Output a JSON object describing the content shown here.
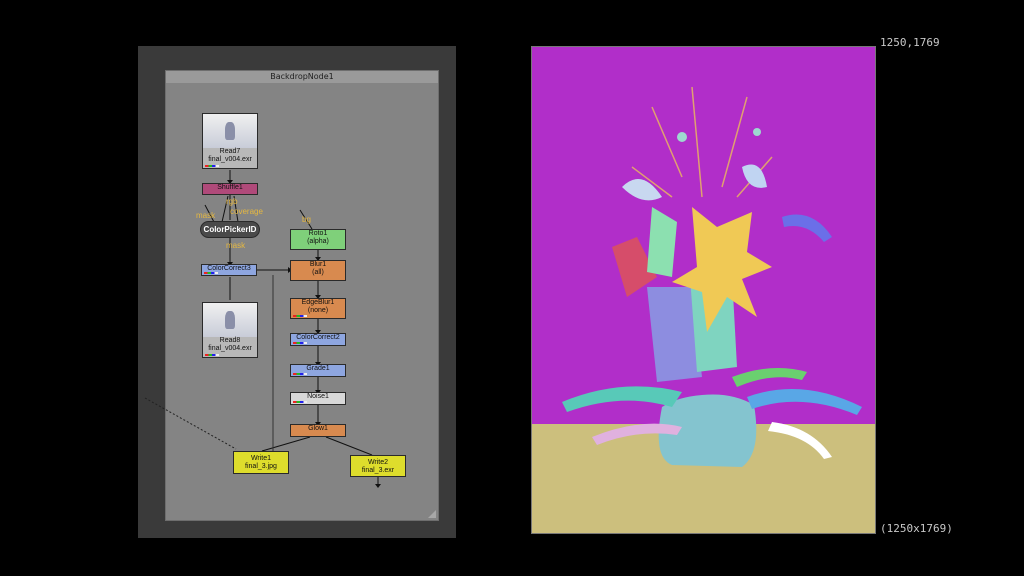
{
  "dag": {
    "backdrop_label": "BackdropNode1",
    "nodes": {
      "read7": {
        "name": "Read7",
        "file": "final_v004.exr"
      },
      "shuffle1": {
        "name": "Shuffle1"
      },
      "colorpicker": {
        "name": "ColorPickerID"
      },
      "colorcorrect3": {
        "name": "ColorCorrect3"
      },
      "read8": {
        "name": "Read8",
        "file": "final_v004.exr"
      },
      "roto1": {
        "name": "Roto1",
        "sub": "(alpha)"
      },
      "blur1": {
        "name": "Blur1",
        "sub": "(all)"
      },
      "edgeblur1": {
        "name": "EdgeBlur1",
        "sub": "(none)"
      },
      "colorcorrect2": {
        "name": "ColorCorrect2"
      },
      "grade1": {
        "name": "Grade1"
      },
      "noise1": {
        "name": "Noise1"
      },
      "glow1": {
        "name": "Glow1"
      },
      "write1": {
        "name": "Write1",
        "file": "final_3.jpg"
      },
      "write2": {
        "name": "Write2",
        "file": "final_3.exr"
      }
    },
    "edge_labels": {
      "rgb": "rgb",
      "mask_a": "mask",
      "coverage": "coverage",
      "mask_b": "mask",
      "bg": "bg"
    }
  },
  "viewer": {
    "coord_readout": "1250,1769",
    "format_label": "(1250x1769)",
    "colors": {
      "background": "#b12ec9",
      "table": "#ccbf7d",
      "vase": "#84c4cf",
      "flower": "#f0c955"
    }
  }
}
